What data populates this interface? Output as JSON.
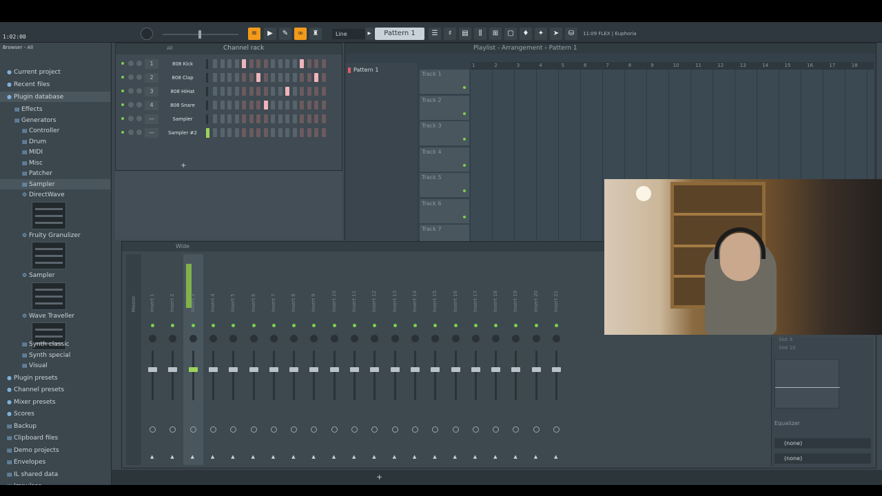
{
  "toolbar": {
    "time": "1:02:00",
    "snap": "Line",
    "pattern": "Pattern 1",
    "news": "11:09  FLEX | Euphoria"
  },
  "browser": {
    "header": "Browser - All",
    "items": [
      {
        "label": "Current project",
        "icon": "project-icon",
        "indent": 0
      },
      {
        "label": "Recent files",
        "icon": "clock-icon",
        "indent": 0
      },
      {
        "label": "Plugin database",
        "icon": "plug-icon",
        "indent": 0,
        "selected": true
      },
      {
        "label": "Effects",
        "icon": "folder-icon",
        "indent": 1
      },
      {
        "label": "Generators",
        "icon": "folder-icon",
        "indent": 1
      },
      {
        "label": "Controller",
        "icon": "folder-icon",
        "indent": 2
      },
      {
        "label": "Drum",
        "icon": "folder-icon",
        "indent": 2
      },
      {
        "label": "MIDI",
        "icon": "folder-icon",
        "indent": 2
      },
      {
        "label": "Misc",
        "icon": "folder-icon",
        "indent": 2
      },
      {
        "label": "Patcher",
        "icon": "folder-icon",
        "indent": 2
      },
      {
        "label": "Sampler",
        "icon": "folder-icon",
        "indent": 2,
        "selected": true
      },
      {
        "label": "DirectWave",
        "icon": "gear-icon",
        "indent": 2
      },
      {
        "label": "Fruity Granulizer",
        "icon": "gear-icon",
        "indent": 2
      },
      {
        "label": "Sampler",
        "icon": "gear-icon",
        "indent": 2
      },
      {
        "label": "Wave Traveller",
        "icon": "gear-icon",
        "indent": 2
      },
      {
        "label": "Synth classic",
        "icon": "folder-icon",
        "indent": 2
      },
      {
        "label": "Synth special",
        "icon": "folder-icon",
        "indent": 2
      },
      {
        "label": "Visual",
        "icon": "folder-icon",
        "indent": 2
      },
      {
        "label": "Plugin presets",
        "icon": "preset-icon",
        "indent": 0
      },
      {
        "label": "Channel presets",
        "icon": "preset-icon",
        "indent": 0
      },
      {
        "label": "Mixer presets",
        "icon": "preset-icon",
        "indent": 0
      },
      {
        "label": "Scores",
        "icon": "note-icon",
        "indent": 0
      },
      {
        "label": "Backup",
        "icon": "folder-icon",
        "indent": 0
      },
      {
        "label": "Clipboard files",
        "icon": "folder-icon",
        "indent": 0
      },
      {
        "label": "Demo projects",
        "icon": "folder-icon",
        "indent": 0
      },
      {
        "label": "Envelopes",
        "icon": "folder-icon",
        "indent": 0
      },
      {
        "label": "IL shared data",
        "icon": "folder-icon",
        "indent": 0
      },
      {
        "label": "Impulses",
        "icon": "folder-icon",
        "indent": 0
      }
    ]
  },
  "channel_rack": {
    "title": "Channel rack",
    "filter": "All",
    "add_label": "+",
    "channels": [
      {
        "num": "1",
        "name": "808 Kick",
        "steps": [
          0,
          0,
          0,
          0,
          1,
          0,
          0,
          0,
          0,
          0,
          0,
          0,
          1,
          0,
          0,
          0
        ]
      },
      {
        "num": "2",
        "name": "808 Clap",
        "steps": [
          0,
          0,
          0,
          0,
          0,
          0,
          1,
          0,
          0,
          0,
          0,
          0,
          0,
          0,
          1,
          0
        ]
      },
      {
        "num": "3",
        "name": "808 HiHat",
        "steps": [
          0,
          0,
          0,
          0,
          0,
          0,
          0,
          0,
          0,
          0,
          1,
          0,
          0,
          0,
          0,
          0
        ]
      },
      {
        "num": "4",
        "name": "808 Snare",
        "steps": [
          0,
          0,
          0,
          0,
          0,
          0,
          0,
          1,
          0,
          0,
          0,
          0,
          0,
          0,
          0,
          0
        ]
      },
      {
        "num": "—",
        "name": "Sampler",
        "steps": [
          0,
          0,
          0,
          0,
          0,
          0,
          0,
          0,
          0,
          0,
          0,
          0,
          0,
          0,
          0,
          0
        ]
      },
      {
        "num": "—",
        "name": "Sampler #2",
        "steps": [
          0,
          0,
          0,
          0,
          0,
          0,
          0,
          0,
          0,
          0,
          0,
          0,
          0,
          0,
          0,
          0
        ],
        "selected": true
      }
    ]
  },
  "playlist": {
    "title": "Playlist - Arrangement › Pattern 1",
    "pattern": "Pattern 1",
    "tracks": [
      "Track 1",
      "Track 2",
      "Track 3",
      "Track 4",
      "Track 5",
      "Track 6",
      "Track 7"
    ],
    "ruler": [
      "1",
      "2",
      "3",
      "4",
      "5",
      "6",
      "7",
      "8",
      "9",
      "10",
      "11",
      "12",
      "13",
      "14",
      "15",
      "16",
      "17",
      "18"
    ]
  },
  "mixer": {
    "title": "Wide",
    "strips": [
      "Insert 1",
      "Insert 2",
      "Insert 3",
      "Insert 4",
      "Insert 5",
      "Insert 6",
      "Insert 7",
      "Insert 8",
      "Insert 9",
      "Insert 10",
      "Insert 11",
      "Insert 12",
      "Insert 13",
      "Insert 14",
      "Insert 15",
      "Insert 16",
      "Insert 17",
      "Insert 18",
      "Insert 19",
      "Insert 20",
      "Insert 21"
    ],
    "master_label": "Master",
    "selected_index": 2,
    "fx_slots": [
      "Slot 9",
      "Slot 10"
    ],
    "eq_label": "Equalizer",
    "route1": "(none)",
    "route2": "(none)"
  }
}
